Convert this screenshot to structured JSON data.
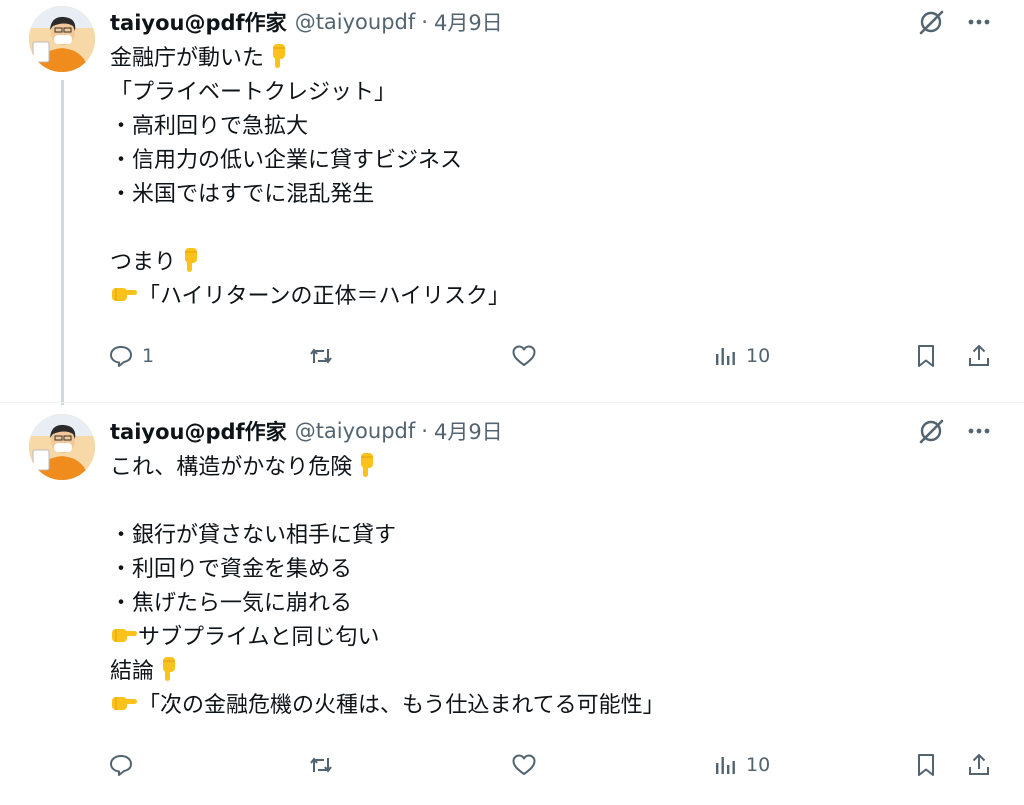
{
  "posts": [
    {
      "author": {
        "name": "taiyou@pdf作家",
        "handle": "@taiyoupdf",
        "date": "4月9日"
      },
      "lines": [
        "金融庁が動いた",
        "「プライベートクレジット」",
        "・高利回りで急拡大",
        "・信用力の低い企業に貸すビジネス",
        "・米国ではすでに混乱発生",
        "",
        "つまり",
        "「ハイリターンの正体＝ハイリスク」"
      ],
      "actions": {
        "replies": "1",
        "reposts": "",
        "likes": "",
        "views": "10"
      }
    },
    {
      "author": {
        "name": "taiyou@pdf作家",
        "handle": "@taiyoupdf",
        "date": "4月9日"
      },
      "lines": [
        "これ、構造がかなり危険",
        "",
        "・銀行が貸さない相手に貸す",
        "・利回りで資金を集める",
        "・焦げたら一気に崩れる",
        "サブプライムと同じ匂い",
        "結論",
        "「次の金融危機の火種は、もう仕込まれてる可能性」"
      ],
      "actions": {
        "replies": "",
        "reposts": "",
        "likes": "",
        "views": "10"
      }
    }
  ],
  "icons": {
    "point_down": "backhand-index-pointing-down",
    "point_right": "backhand-index-pointing-right",
    "emoji_color": "#fcc21b"
  }
}
